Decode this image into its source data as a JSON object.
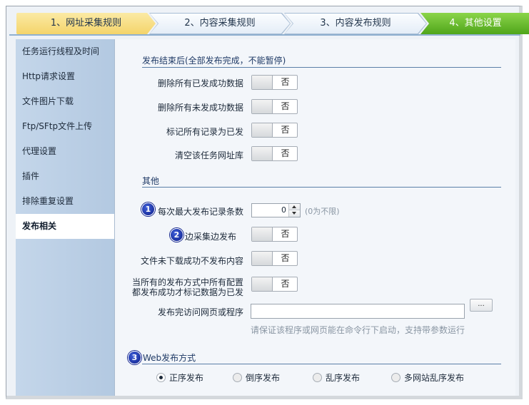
{
  "wizard": {
    "steps": [
      {
        "label": "1、网址采集规则"
      },
      {
        "label": "2、内容采集规则"
      },
      {
        "label": "3、内容发布规则"
      },
      {
        "label": "4、其他设置"
      }
    ]
  },
  "sidebar": {
    "items": [
      {
        "label": "任务运行线程及时间"
      },
      {
        "label": "Http请求设置"
      },
      {
        "label": "文件图片下载"
      },
      {
        "label": "Ftp/SFtp文件上传"
      },
      {
        "label": "代理设置"
      },
      {
        "label": "插件"
      },
      {
        "label": "排除重复设置"
      },
      {
        "label": "发布相关",
        "active": true
      }
    ]
  },
  "section_after_publish": {
    "title": "发布结束后(全部发布完成，不能暂停)",
    "rows": [
      {
        "label": "删除所有已发成功数据",
        "toggle": "否"
      },
      {
        "label": "删除所有未发成功数据",
        "toggle": "否"
      },
      {
        "label": "标记所有记录为已发",
        "toggle": "否"
      },
      {
        "label": "清空该任务网址库",
        "toggle": "否"
      }
    ]
  },
  "section_other": {
    "title": "其他",
    "max_records_label": "每次最大发布记录条数",
    "max_records_value": "0",
    "max_records_hint": "(0为不限)",
    "collect_publish_label": "边采集边发布",
    "collect_publish_toggle": "否",
    "file_fail_label": "文件未下载成功不发布内容",
    "file_fail_toggle": "否",
    "all_success_label_line1": "当所有的发布方式中所有配置",
    "all_success_label_line2": "都发布成功才标记数据为已发",
    "all_success_toggle": "否",
    "visit_label": "发布完访问网页或程序",
    "visit_value": "",
    "browse_label": "...",
    "visit_hint": "请保证该程序或网页能在命令行下启动，支持带参数运行"
  },
  "section_web": {
    "title": "Web发布方式",
    "options": [
      {
        "label": "正序发布",
        "checked": true
      },
      {
        "label": "倒序发布",
        "checked": false
      },
      {
        "label": "乱序发布",
        "checked": false
      },
      {
        "label": "多网站乱序发布",
        "checked": false
      }
    ]
  },
  "badges": [
    "1",
    "2",
    "3"
  ]
}
